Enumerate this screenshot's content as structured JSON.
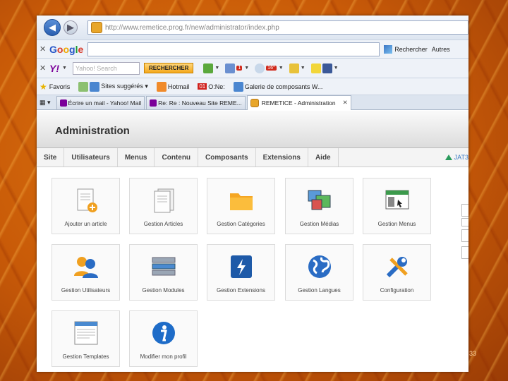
{
  "browser": {
    "url": "http://www.remetice.prog.fr/new/administrator/index.php",
    "back_label": "◀",
    "forward_label": "▶"
  },
  "google_bar": {
    "close": "✕",
    "logo": [
      "G",
      "o",
      "o",
      "g",
      "l",
      "e"
    ],
    "rechercher": "Rechercher",
    "autres": "Autres"
  },
  "yahoo_bar": {
    "close": "✕",
    "logo": "Y!",
    "search_placeholder": "Yahoo! Search",
    "rechercher_button": "RECHERCHER",
    "mail_badge": "1",
    "weather_badge": "16°"
  },
  "favorites_bar": {
    "favoris": "Favoris",
    "items": [
      "Sites suggérés ▾",
      "Hotmail",
      "O:Ne:",
      "Galerie de composants W..."
    ],
    "o1_logo": "01"
  },
  "tabs": [
    {
      "label": "Écrire un mail - Yahoo! Mail",
      "active": false
    },
    {
      "label": "Re: Re : Nouveau Site REME...",
      "active": false
    },
    {
      "label": "REMETICE - Administration",
      "active": true,
      "close": "✕"
    }
  ],
  "admin": {
    "title": "Administration",
    "menu": [
      "Site",
      "Utilisateurs",
      "Menus",
      "Contenu",
      "Composants",
      "Extensions",
      "Aide"
    ],
    "brand": "JAT3"
  },
  "cards": [
    {
      "label": "Ajouter un article",
      "icon": "add-article-icon"
    },
    {
      "label": "Gestion Articles",
      "icon": "articles-icon"
    },
    {
      "label": "Gestion Catégories",
      "icon": "folder-icon"
    },
    {
      "label": "Gestion Médias",
      "icon": "media-icon"
    },
    {
      "label": "Gestion Menus",
      "icon": "menu-manager-icon"
    },
    {
      "label": "Gestion Utilisateurs",
      "icon": "users-icon"
    },
    {
      "label": "Gestion Modules",
      "icon": "modules-icon"
    },
    {
      "label": "Gestion Extensions",
      "icon": "extensions-icon"
    },
    {
      "label": "Gestion Langues",
      "icon": "globe-icon"
    },
    {
      "label": "Configuration",
      "icon": "tools-icon"
    },
    {
      "label": "Gestion Templates",
      "icon": "templates-icon"
    },
    {
      "label": "Modifier mon profil",
      "icon": "info-icon"
    }
  ],
  "page_number": "33"
}
